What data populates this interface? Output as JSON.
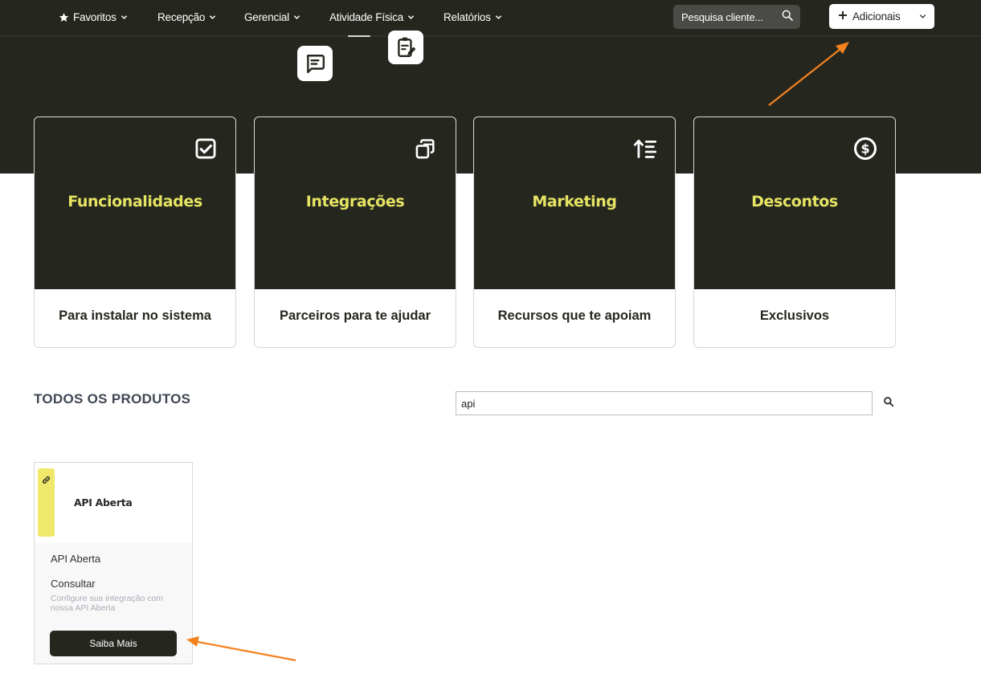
{
  "nav": {
    "items": [
      {
        "label": "Favoritos",
        "icon": "star-icon"
      },
      {
        "label": "Recepção"
      },
      {
        "label": "Gerencial"
      },
      {
        "label": "Atividade Física"
      },
      {
        "label": "Relatórios"
      }
    ],
    "search_placeholder": "Pesquisa cliente...",
    "add_label": "Adicionais"
  },
  "floating_icons": [
    "chat-message-icon",
    "clipboard-edit-icon"
  ],
  "categories": [
    {
      "title": "Funcionalidades",
      "subtitle": "Para instalar no sistema",
      "icon": "checkbox-icon"
    },
    {
      "title": "Integrações",
      "subtitle": "Parceiros para te ajudar",
      "icon": "copy-stack-icon"
    },
    {
      "title": "Marketing",
      "subtitle": "Recursos que te apoiam",
      "icon": "sort-up-icon"
    },
    {
      "title": "Descontos",
      "subtitle": "Exclusivos",
      "icon": "dollar-circle-icon"
    }
  ],
  "products_section": {
    "title": "TODOS OS PRODUTOS",
    "search_value": "api"
  },
  "products": [
    {
      "thumb_title": "API Aberta",
      "name": "API Aberta",
      "action": "Consultar",
      "description": "Configure sua integração com nossa API Aberta",
      "button_label": "Saiba Mais",
      "tag_icon": "link-icon"
    }
  ],
  "colors": {
    "dark": "#25271f",
    "accent_yellow": "#e6e463",
    "tag_yellow": "#efe86a",
    "annotation_orange": "#f5821f"
  }
}
